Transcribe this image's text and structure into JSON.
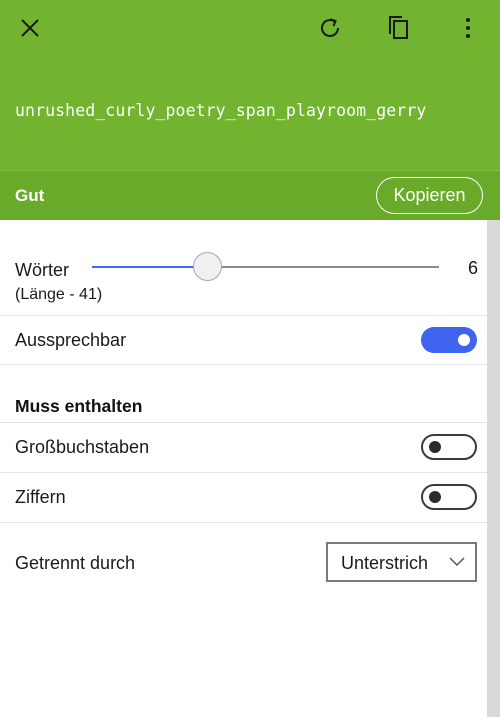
{
  "header": {
    "close_icon": "close-icon",
    "refresh_icon": "refresh-icon",
    "copy_icon": "copy-icon",
    "more_icon": "more-vertical-icon",
    "password": "unrushed_curly_poetry_span_playroom_gerry",
    "background_color": "#72b42f"
  },
  "strength": {
    "label": "Gut",
    "copy_button": "Kopieren"
  },
  "settings": {
    "words": {
      "label": "Wörter",
      "value": "6",
      "length_note": "(Länge - 41)",
      "slider_fraction": 0.33
    },
    "pronounceable": {
      "label": "Aussprechbar",
      "enabled": true
    },
    "must_contain": {
      "title": "Muss enthalten",
      "uppercase": {
        "label": "Großbuchstaben",
        "enabled": false
      },
      "digits": {
        "label": "Ziffern",
        "enabled": false
      }
    },
    "separator": {
      "label": "Getrennt durch",
      "selected": "Unterstrich"
    }
  },
  "colors": {
    "accent": "#3e64f0",
    "strength_bar": "#6aaa2a"
  }
}
